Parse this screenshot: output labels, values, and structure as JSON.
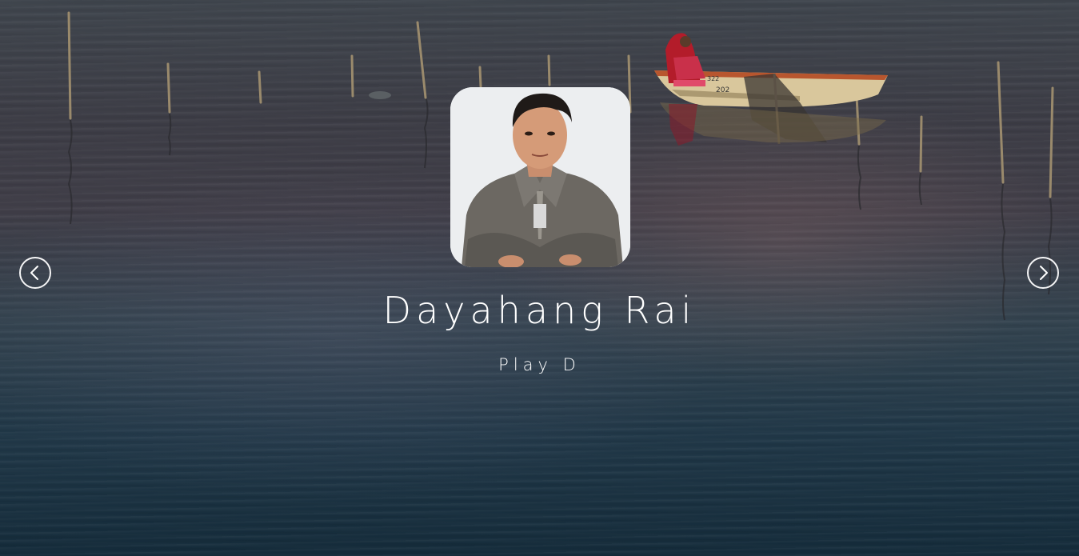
{
  "slide": {
    "person_name": "Dayahang Rai",
    "person_role": "Play D"
  },
  "background": {
    "scene": "lake with bamboo poles and a wooden fishing boat",
    "boat_numbers": [
      "322",
      "202"
    ]
  },
  "navigation": {
    "prev_icon": "chevron-left-icon",
    "next_icon": "chevron-right-icon"
  },
  "colors": {
    "text": "#ffffff",
    "water_top": "#3f454d",
    "water_bottom": "#152c3b"
  }
}
